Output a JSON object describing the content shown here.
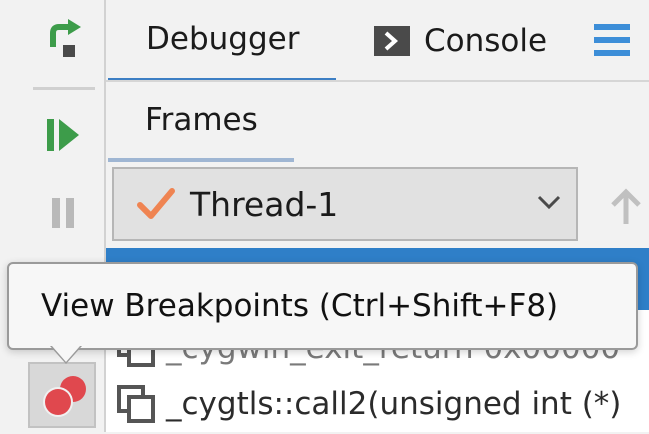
{
  "toolbar": {
    "restart_icon": "restart-icon",
    "resume_icon": "resume-icon",
    "pause_icon": "pause-icon",
    "breakpoints_icon": "view-breakpoints-icon"
  },
  "tabs": [
    {
      "label": "Debugger",
      "active": true
    },
    {
      "label": "Console",
      "icon": "console-icon"
    }
  ],
  "menu_icon": "hamburger-menu-icon",
  "subtabs": [
    {
      "label": "Frames",
      "active": true
    }
  ],
  "thread_select": {
    "value": "Thread-1",
    "icon": "checkmark-icon"
  },
  "frames": [
    {
      "label": "",
      "selected": true
    },
    {
      "label": "_cygwin_exit_return 0x00000",
      "partial": true
    },
    {
      "label": "_cygtls::call2(unsigned int (*)"
    }
  ],
  "tooltip": {
    "text": "View Breakpoints (Ctrl+Shift+F8)"
  },
  "colors": {
    "accent": "#3d7fc4",
    "selected_row": "#2f7fc8",
    "restart_green": "#3d9c4a",
    "breakpoint_red": "#e0484e"
  }
}
